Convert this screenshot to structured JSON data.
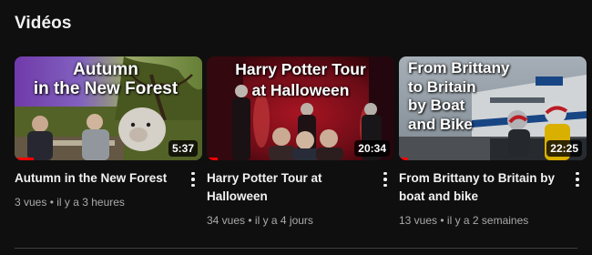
{
  "section": {
    "title": "Vidéos"
  },
  "videos": [
    {
      "thumb_text": "Autumn\nin the New Forest",
      "duration": "5:37",
      "progress_fraction": 0.1,
      "title": "Autumn in the New Forest",
      "stats": "3 vues • il y a 3 heures",
      "thumb_icon": "autumn-forest-thumbnail"
    },
    {
      "thumb_text": "Harry Potter Tour\nat Halloween",
      "duration": "20:34",
      "progress_fraction": 0.06,
      "title": "Harry Potter Tour at Halloween",
      "stats": "34 vues • il y a 4 jours",
      "thumb_icon": "halloween-tour-thumbnail"
    },
    {
      "thumb_text": "From Brittany\nto Britain\nby Boat\nand Bike",
      "duration": "22:25",
      "progress_fraction": 0.05,
      "title": "From Brittany to Britain by boat and bike",
      "stats": "13 vues • il y a 2 semaines",
      "thumb_icon": "ferry-motorbike-thumbnail"
    }
  ],
  "menu_icon": "more-vertical-icon",
  "colors": {
    "background": "#0f0f0f",
    "text_primary": "#f1f1f1",
    "text_secondary": "#aaaaaa",
    "progress": "#ff0000"
  }
}
